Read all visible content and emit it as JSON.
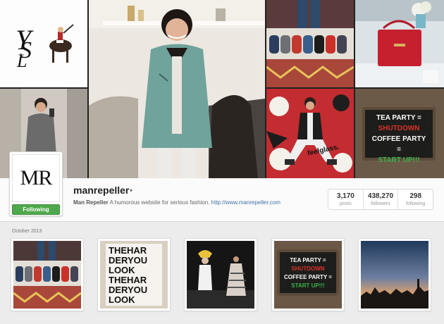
{
  "profile": {
    "username": "manrepeller",
    "avatar_text": "MR",
    "follow_button": "Following",
    "bio_name": "Man Repeller",
    "bio_text": " A humorous website for serious fashion. ",
    "bio_link": "http://www.manrepeller.com"
  },
  "stats": [
    {
      "value": "3,170",
      "label": "posts"
    },
    {
      "value": "438,270",
      "label": "followers"
    },
    {
      "value": "298",
      "label": "following"
    }
  ],
  "feed": {
    "month_label": "October 2013"
  },
  "cover_text": {
    "feelglass": "feelglass.",
    "sign_line1": "TEA PARTY =",
    "sign_line2": "SHUTDOWN",
    "sign_line3": "COFFEE PARTY =",
    "sign_line4": "START UP!!!"
  },
  "poster_lines": [
    "THEHAR",
    "DERYOU",
    "LOOK",
    "THEHAR",
    "DERYOU",
    "LOOK"
  ],
  "colors": {
    "follow_green": "#4fa84c",
    "link_blue": "#3f72a5",
    "sign_red": "#d9332a",
    "sign_green": "#3bb34a"
  },
  "icons": {
    "username_caret": "▾"
  }
}
